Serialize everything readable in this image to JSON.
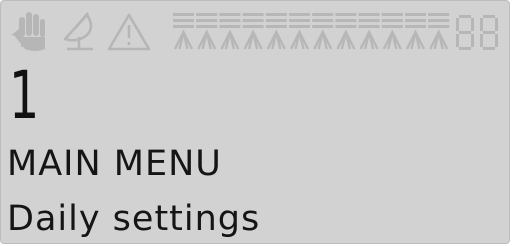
{
  "display": {
    "background_color": "#d2d2d2",
    "segment_on_color": "#151515",
    "segment_off_color": "#b7b7b7"
  },
  "status_bar": {
    "icons": [
      "hand-icon",
      "satellite-dish-icon",
      "warning-triangle-icon"
    ],
    "section_indicator_count": 12,
    "two_digit_readout": "88"
  },
  "main": {
    "menu_number": "1",
    "menu_title": "MAIN MENU",
    "menu_item": "Daily settings"
  }
}
